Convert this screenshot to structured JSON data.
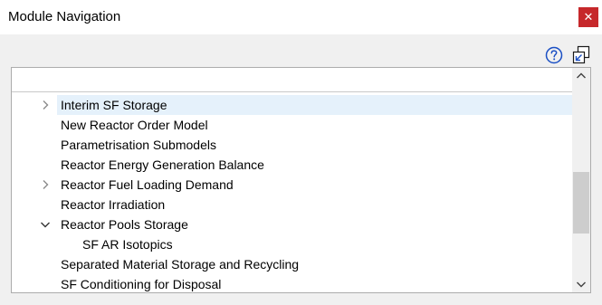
{
  "window": {
    "title": "Module Navigation",
    "close_glyph": "✕"
  },
  "toolbar": {
    "help_icon": "question-circle-icon",
    "popout_icon": "window-popout-icon"
  },
  "tree": {
    "items": [
      {
        "label": "Interim SF Storage",
        "expander": "collapsed",
        "selected": true,
        "level": 0
      },
      {
        "label": "New Reactor Order Model",
        "expander": "none",
        "selected": false,
        "level": 0
      },
      {
        "label": "Parametrisation Submodels",
        "expander": "none",
        "selected": false,
        "level": 0
      },
      {
        "label": "Reactor Energy Generation Balance",
        "expander": "none",
        "selected": false,
        "level": 0
      },
      {
        "label": "Reactor Fuel Loading Demand",
        "expander": "collapsed",
        "selected": false,
        "level": 0
      },
      {
        "label": "Reactor Irradiation",
        "expander": "none",
        "selected": false,
        "level": 0
      },
      {
        "label": "Reactor Pools Storage",
        "expander": "expanded",
        "selected": false,
        "level": 0
      },
      {
        "label": "SF AR Isotopics",
        "expander": "none",
        "selected": false,
        "level": 1
      },
      {
        "label": "Separated Material Storage and Recycling",
        "expander": "none",
        "selected": false,
        "level": 0
      },
      {
        "label": "SF Conditioning for Disposal",
        "expander": "none",
        "selected": false,
        "level": 0
      }
    ]
  },
  "colors": {
    "close_bg": "#c6282b",
    "selection_bg": "#e5f1fb",
    "help_blue": "#1a4fc4"
  }
}
